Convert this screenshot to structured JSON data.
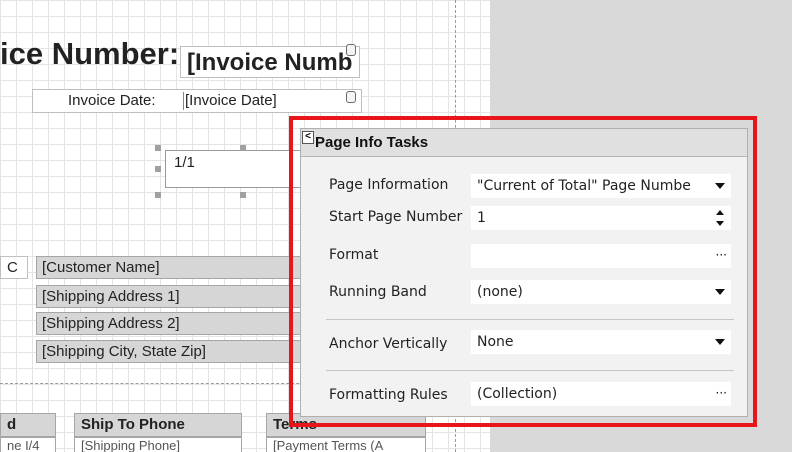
{
  "designer": {
    "title_label": "ice Number:",
    "title_field": "[Invoice Numb",
    "date_label": "Invoice Date:",
    "date_field": "[Invoice Date]",
    "page_info_text": "1/1",
    "customer_stub": "C",
    "address_rows": [
      "[Customer Name]",
      "[Shipping Address 1]",
      "[Shipping Address 2]",
      "[Shipping City, State Zip]"
    ],
    "footer_headers": [
      "d",
      "Ship To Phone",
      "Terms"
    ],
    "footer_subs": [
      "ne I/4",
      "[Shipping Phone]",
      "[Payment Terms (A"
    ]
  },
  "tasks_panel": {
    "title": "Page Info Tasks",
    "rows": [
      {
        "label": "Page Information",
        "value": "\"Current of Total\" Page Numbe",
        "control": "dropdown"
      },
      {
        "label": "Start Page Number",
        "value": "1",
        "control": "spinner"
      },
      {
        "label": "Format",
        "value": "",
        "control": "ellipsis"
      },
      {
        "label": "Running Band",
        "value": "(none)",
        "control": "dropdown"
      },
      {
        "label": "Anchor Vertically",
        "value": "None",
        "control": "dropdown"
      },
      {
        "label": "Formatting Rules",
        "value": "(Collection)",
        "control": "ellipsis"
      }
    ],
    "ellipsis_glyph": "···",
    "collapse_glyph": "<"
  },
  "colors": {
    "highlight": "#e8151b",
    "panel_bg": "#f2f2f2",
    "field_bg": "#d6d6d6"
  },
  "icons": {
    "smart_tag": "smart-tag-icon",
    "dropdown": "chevron-down-icon",
    "spinner": "spinner-icon",
    "ellipsis": "ellipsis-icon"
  }
}
